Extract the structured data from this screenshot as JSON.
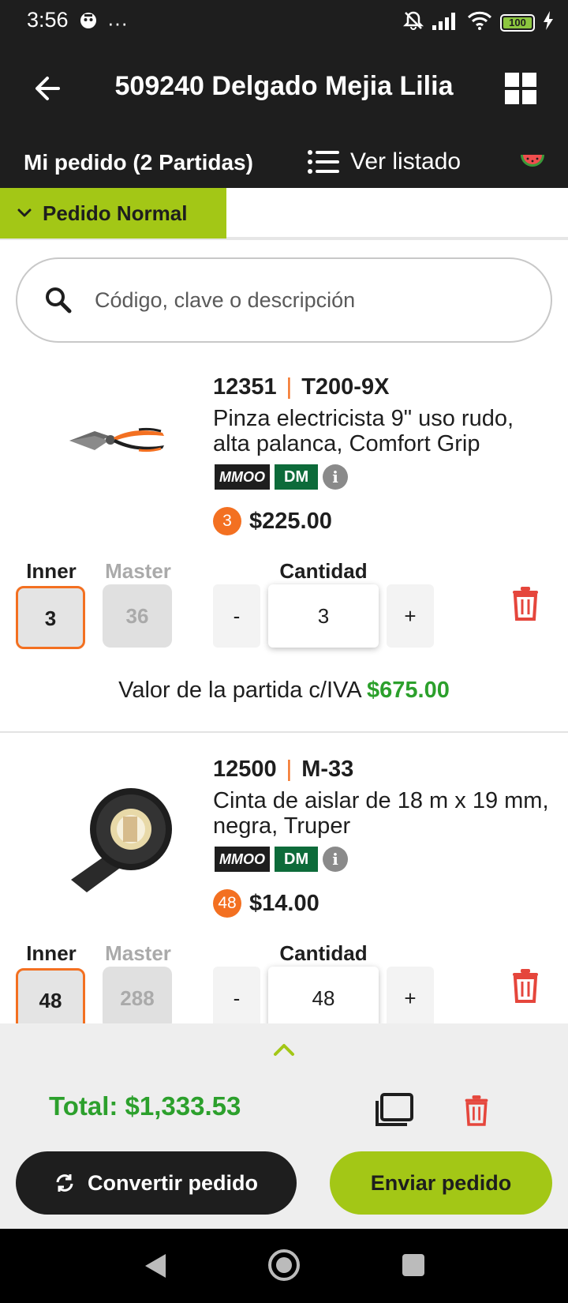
{
  "status_bar": {
    "time": "3:56",
    "dots": "···",
    "battery": "100"
  },
  "app_bar": {
    "title": "509240 Delgado Mejia Lilia"
  },
  "order_bar": {
    "count_label": "Mi pedido (2 Partidas)",
    "list_label": "Ver listado"
  },
  "tab": {
    "active_label": "Pedido Normal"
  },
  "search": {
    "placeholder": "Código, clave o descripción"
  },
  "labels": {
    "inner": "Inner",
    "master": "Master",
    "cantidad": "Cantidad",
    "line_value": "Valor de la partida c/IVA",
    "minus": "-",
    "plus": "+",
    "info": "i"
  },
  "badges": {
    "mmoo": "MMOO",
    "dm": "DM"
  },
  "products": [
    {
      "code": "12351",
      "sku": "T200-9X",
      "description": "Pinza electricista 9\" uso rudo, alta palanca, Comfort Grip",
      "pack_qty": "3",
      "price": "$225.00",
      "inner": "3",
      "master": "36",
      "quantity": "3",
      "line_total": "$675.00"
    },
    {
      "code": "12500",
      "sku": "M-33",
      "description": "Cinta de aislar de 18 m x 19 mm, negra, Truper",
      "pack_qty": "48",
      "price": "$14.00",
      "inner": "48",
      "master": "288",
      "quantity": "48"
    }
  ],
  "summary": {
    "total": "Total: $1,333.53",
    "convert_label": "Convertir pedido",
    "send_label": "Enviar pedido"
  },
  "colors": {
    "accent": "#a3c716",
    "orange": "#f37021",
    "green_text": "#2ca02c",
    "dark": "#1e1e1e",
    "danger": "#e5463c"
  }
}
